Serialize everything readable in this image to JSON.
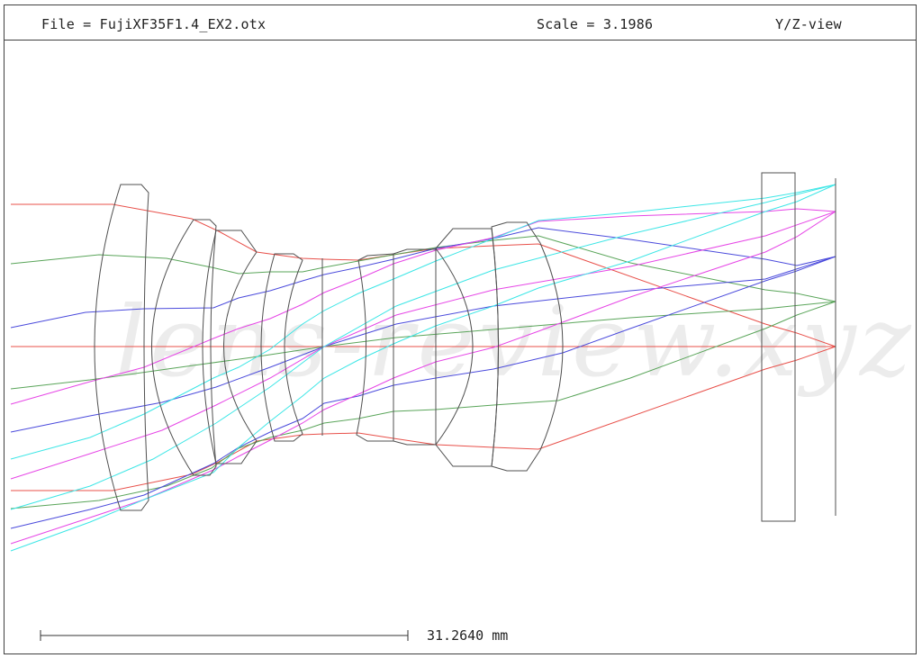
{
  "header": {
    "file_text": "File = FujiXF35F1.4_EX2.otx",
    "scale_text": "Scale = 3.1986",
    "view_text": "Y/Z-view"
  },
  "scale_bar": {
    "label": "31.2640 mm"
  },
  "watermark": {
    "text": "lens-review.xyz"
  },
  "colors": {
    "frame": "#404040",
    "lens": "#505050",
    "ray_axial": "#e8504a",
    "ray_field_1": "#5aa55a",
    "ray_field_2": "#4b4bdc",
    "ray_field_3": "#e646e6",
    "ray_field_4": "#3ce6e6"
  },
  "icons": {
    "scale_bar": "scale-bar-icon"
  }
}
